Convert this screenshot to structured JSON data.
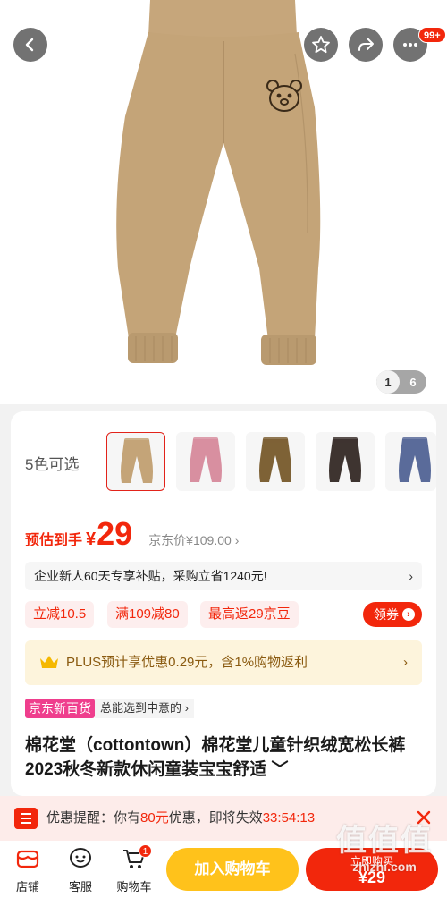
{
  "header": {
    "notification_count": "99+"
  },
  "gallery": {
    "current": "1",
    "total": "6"
  },
  "colors": {
    "label": "5色可选",
    "swatches": [
      "#c4a478",
      "#d88fa0",
      "#7e6236",
      "#3e3430",
      "#5a6b9a"
    ]
  },
  "price": {
    "prefix": "预估到手",
    "yen": "¥",
    "value": "29",
    "jd_price": "京东价¥109.00",
    "jd_price_arrow": "›"
  },
  "subsidy": {
    "text": "企业新人60天专享补贴，采购立省1240元!",
    "arrow": "›"
  },
  "promos": {
    "tags": [
      "立减10.5",
      "满109减80",
      "最高返29京豆"
    ],
    "coupon_label": "领券",
    "coupon_icon": "›"
  },
  "plus": {
    "text_prefix": "PLUS预计享优惠0.29元，含1%购物返利",
    "arrow": "›"
  },
  "dept": {
    "badge": "京东新百货",
    "note": "总能选到中意的 ›"
  },
  "product": {
    "title": "棉花堂（cottontown）棉花堂儿童针织绒宽松长裤2023秋冬新款休闲童装宝宝舒适 ﹀"
  },
  "reminder": {
    "label": "优惠提醒：你有",
    "amount": "80元",
    "middle": "优惠，即将失效",
    "countdown": "33:54:13"
  },
  "bottom_bar": {
    "shop": "店铺",
    "service": "客服",
    "cart": "购物车",
    "cart_count": "1",
    "add_to_cart": "加入购物车",
    "buy_now_top": "立即购买",
    "buy_now_price": "¥29"
  },
  "watermark": {
    "big": "值值值",
    "small": "zhizhi.com"
  },
  "theme": {
    "accent": "#f2270c",
    "pants_color": "#c4a478"
  }
}
